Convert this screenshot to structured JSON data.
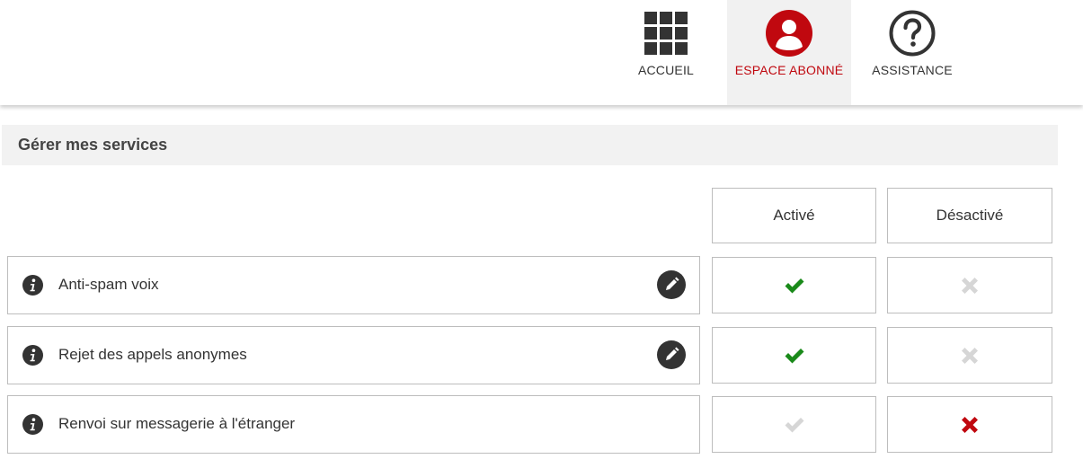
{
  "header": {
    "nav": [
      {
        "label": "ACCUEIL",
        "icon": "grid-icon",
        "color": "#333333"
      },
      {
        "label": "ESPACE ABONNÉ",
        "icon": "user-icon",
        "color": "#c0080f",
        "active": true
      },
      {
        "label": "ASSISTANCE",
        "icon": "help-icon",
        "color": "#333333"
      }
    ]
  },
  "section": {
    "title": "Gérer mes services"
  },
  "table": {
    "columns": {
      "active": "Activé",
      "inactive": "Désactivé"
    },
    "rows": [
      {
        "label": "Anti-spam voix",
        "editable": true,
        "active": true
      },
      {
        "label": "Rejet des appels anonymes",
        "editable": true,
        "active": true
      },
      {
        "label": "Renvoi sur messagerie à l'étranger",
        "editable": false,
        "active": false
      }
    ]
  },
  "colors": {
    "brand_red": "#c0080f",
    "check_green": "#1a8a1a",
    "disabled_grey": "#d6d6d6",
    "icon_dark": "#333333"
  }
}
